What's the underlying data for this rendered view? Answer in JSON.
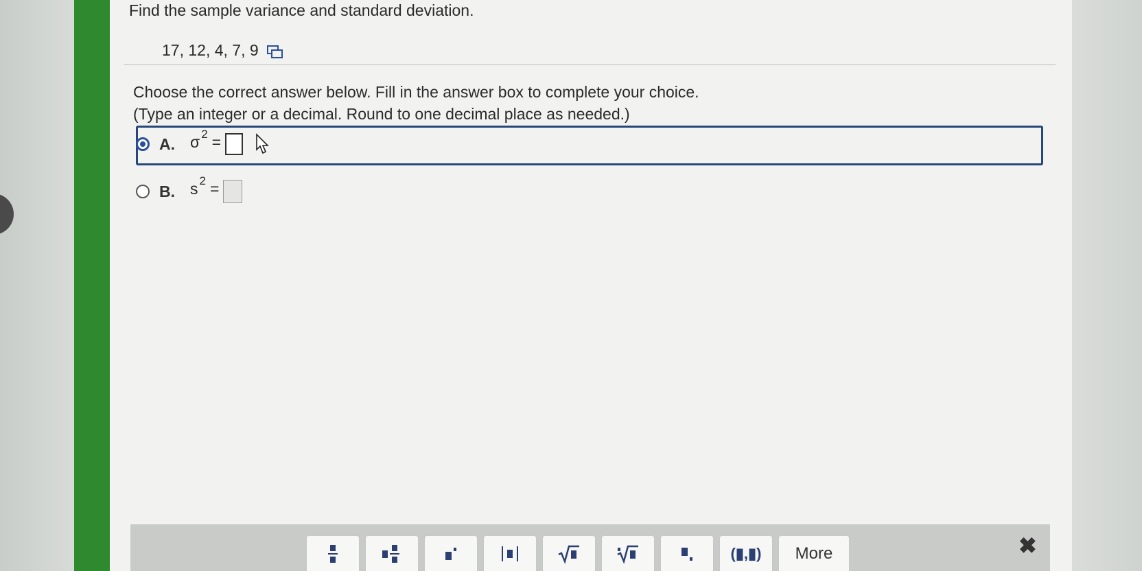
{
  "question": {
    "title": "Find the sample variance and standard deviation.",
    "dataset": "17, 12, 4, 7, 9"
  },
  "instructions": {
    "line1": "Choose the correct answer below. Fill in the answer box to complete your choice.",
    "line2": "(Type an integer or a decimal. Round to one decimal place as needed.)"
  },
  "options": [
    {
      "letter": "A.",
      "symbol": "σ",
      "exponent": "2",
      "equals": "=",
      "selected": true,
      "value": ""
    },
    {
      "letter": "B.",
      "symbol": "s",
      "exponent": "2",
      "equals": "=",
      "selected": false,
      "value": ""
    }
  ],
  "toolbar": {
    "more_label": "More",
    "paren_label": "(▮,▮)",
    "close_label": "✖",
    "icons": [
      "fraction-icon",
      "mixed-number-icon",
      "exponent-icon",
      "absolute-value-icon",
      "square-root-icon",
      "nth-root-icon",
      "subscript-icon",
      "ordered-pair-icon"
    ]
  },
  "colors": {
    "accent": "#2b4f9e",
    "sidebar_green": "#2f8a2f",
    "toolbar_icon": "#2b3f73"
  }
}
